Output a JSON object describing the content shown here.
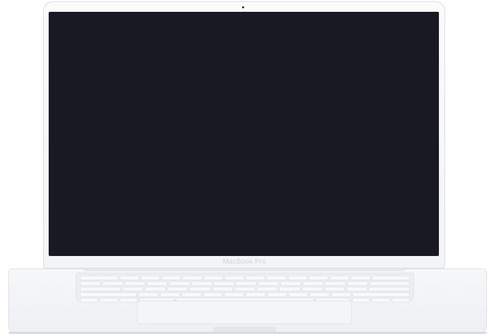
{
  "device": {
    "model_label": "MacBook Pro",
    "screen_state": "off",
    "colors": {
      "screen": "#191923",
      "body": "#f3f4f6",
      "keyboard": "#eceef1"
    }
  }
}
